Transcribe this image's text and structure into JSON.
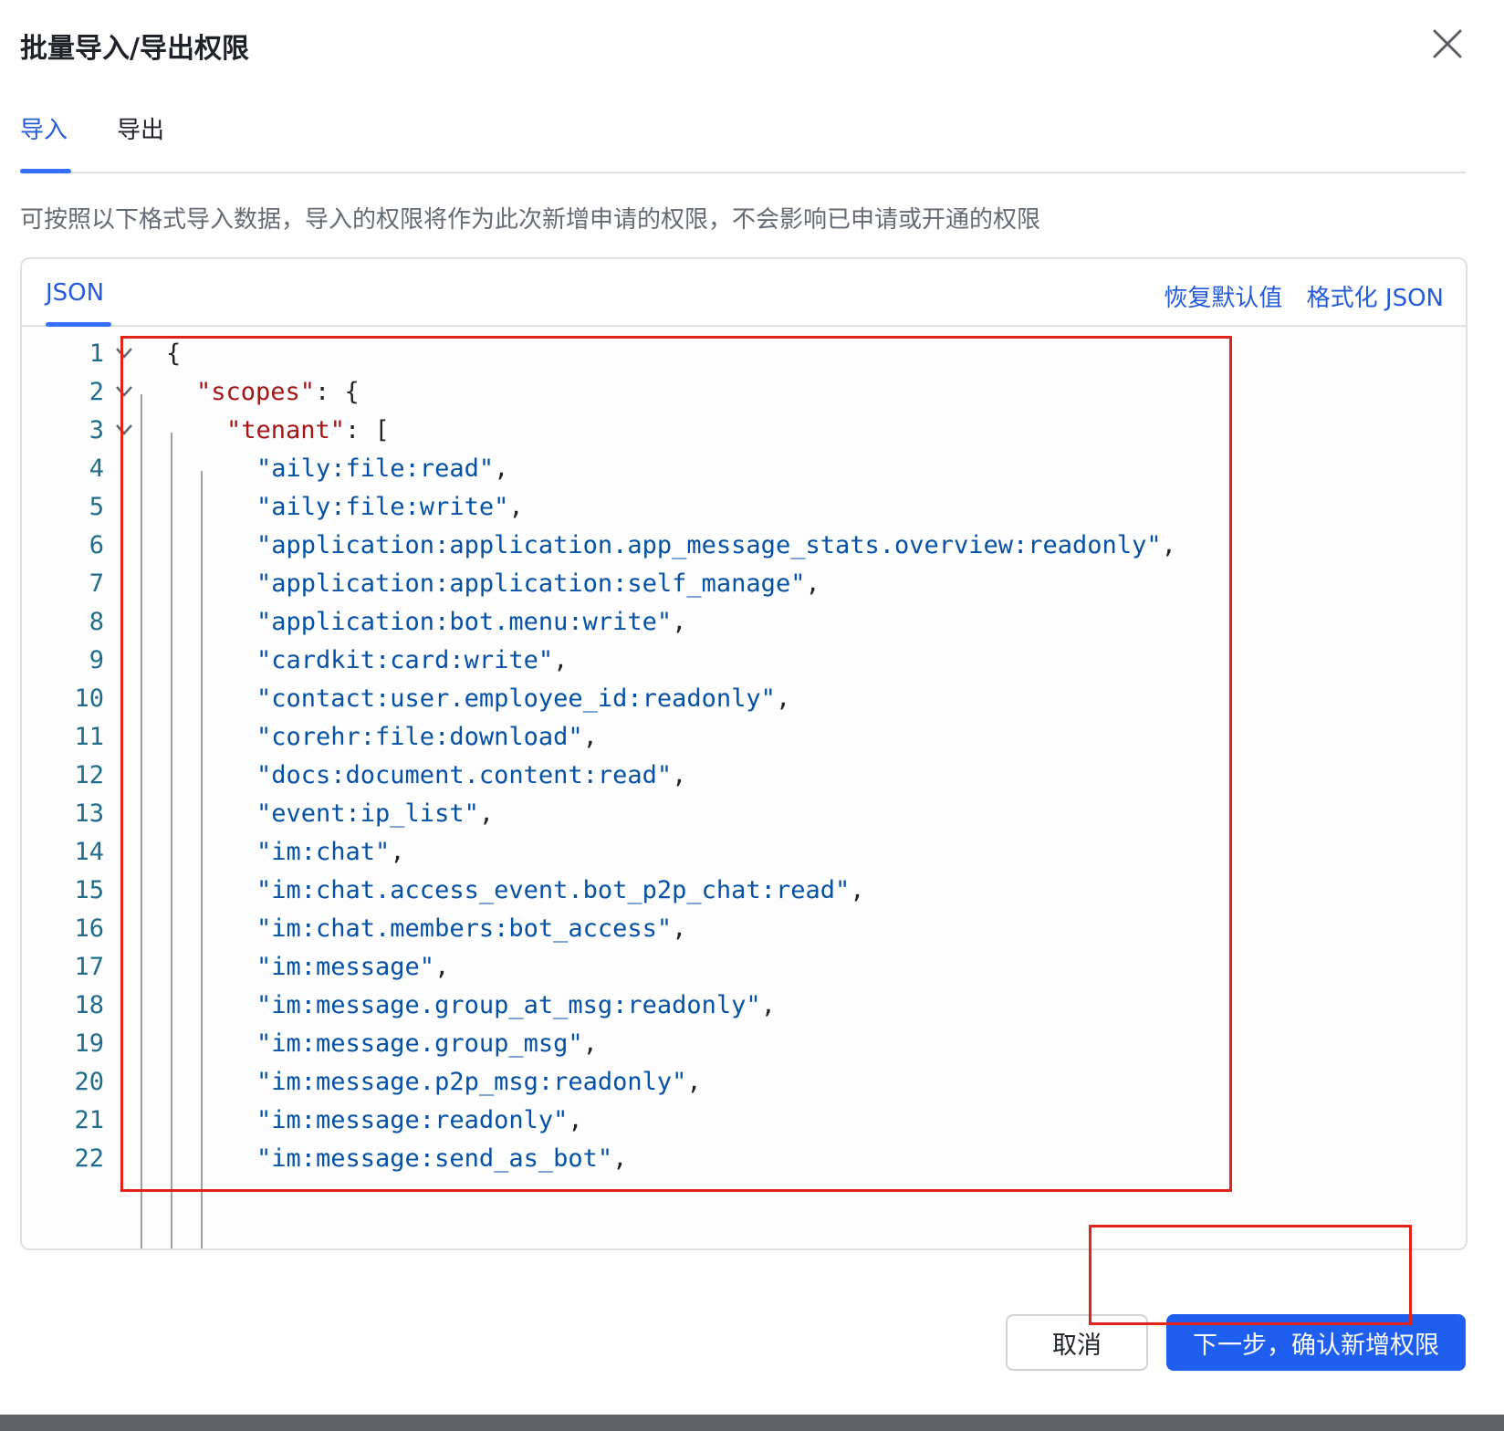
{
  "dialog": {
    "title": "批量导入/导出权限",
    "close_icon": "close-icon"
  },
  "tabs": [
    {
      "label": "导入",
      "active": true
    },
    {
      "label": "导出",
      "active": false
    }
  ],
  "description": "可按照以下格式导入数据，导入的权限将作为此次新增申请的权限，不会影响已申请或开通的权限",
  "editor": {
    "tab_label": "JSON",
    "actions": {
      "restore_default": "恢复默认值",
      "format_json": "格式化 JSON"
    },
    "lines": [
      {
        "n": "1",
        "fold": true,
        "indent": 0,
        "key": "",
        "str": "",
        "text": "{"
      },
      {
        "n": "2",
        "fold": true,
        "indent": 1,
        "key": "\"scopes\"",
        "str": "",
        "text": ": {"
      },
      {
        "n": "3",
        "fold": true,
        "indent": 2,
        "key": "\"tenant\"",
        "str": "",
        "text": ": ["
      },
      {
        "n": "4",
        "fold": false,
        "indent": 3,
        "key": "",
        "str": "\"aily:file:read\"",
        "text": ","
      },
      {
        "n": "5",
        "fold": false,
        "indent": 3,
        "key": "",
        "str": "\"aily:file:write\"",
        "text": ","
      },
      {
        "n": "6",
        "fold": false,
        "indent": 3,
        "key": "",
        "str": "\"application:application.app_message_stats.overview:readonly\"",
        "text": ","
      },
      {
        "n": "7",
        "fold": false,
        "indent": 3,
        "key": "",
        "str": "\"application:application:self_manage\"",
        "text": ","
      },
      {
        "n": "8",
        "fold": false,
        "indent": 3,
        "key": "",
        "str": "\"application:bot.menu:write\"",
        "text": ","
      },
      {
        "n": "9",
        "fold": false,
        "indent": 3,
        "key": "",
        "str": "\"cardkit:card:write\"",
        "text": ","
      },
      {
        "n": "10",
        "fold": false,
        "indent": 3,
        "key": "",
        "str": "\"contact:user.employee_id:readonly\"",
        "text": ","
      },
      {
        "n": "11",
        "fold": false,
        "indent": 3,
        "key": "",
        "str": "\"corehr:file:download\"",
        "text": ","
      },
      {
        "n": "12",
        "fold": false,
        "indent": 3,
        "key": "",
        "str": "\"docs:document.content:read\"",
        "text": ","
      },
      {
        "n": "13",
        "fold": false,
        "indent": 3,
        "key": "",
        "str": "\"event:ip_list\"",
        "text": ","
      },
      {
        "n": "14",
        "fold": false,
        "indent": 3,
        "key": "",
        "str": "\"im:chat\"",
        "text": ","
      },
      {
        "n": "15",
        "fold": false,
        "indent": 3,
        "key": "",
        "str": "\"im:chat.access_event.bot_p2p_chat:read\"",
        "text": ","
      },
      {
        "n": "16",
        "fold": false,
        "indent": 3,
        "key": "",
        "str": "\"im:chat.members:bot_access\"",
        "text": ","
      },
      {
        "n": "17",
        "fold": false,
        "indent": 3,
        "key": "",
        "str": "\"im:message\"",
        "text": ","
      },
      {
        "n": "18",
        "fold": false,
        "indent": 3,
        "key": "",
        "str": "\"im:message.group_at_msg:readonly\"",
        "text": ","
      },
      {
        "n": "19",
        "fold": false,
        "indent": 3,
        "key": "",
        "str": "\"im:message.group_msg\"",
        "text": ","
      },
      {
        "n": "20",
        "fold": false,
        "indent": 3,
        "key": "",
        "str": "\"im:message.p2p_msg:readonly\"",
        "text": ","
      },
      {
        "n": "21",
        "fold": false,
        "indent": 3,
        "key": "",
        "str": "\"im:message:readonly\"",
        "text": ","
      },
      {
        "n": "22",
        "fold": false,
        "indent": 3,
        "key": "",
        "str": "\"im:message:send_as_bot\"",
        "text": ","
      }
    ]
  },
  "footer": {
    "cancel_label": "取消",
    "next_label": "下一步，确认新增权限"
  },
  "colors": {
    "accent": "#245bdb",
    "primary_button": "#1f5ff0",
    "highlight_box": "#e2231a"
  }
}
